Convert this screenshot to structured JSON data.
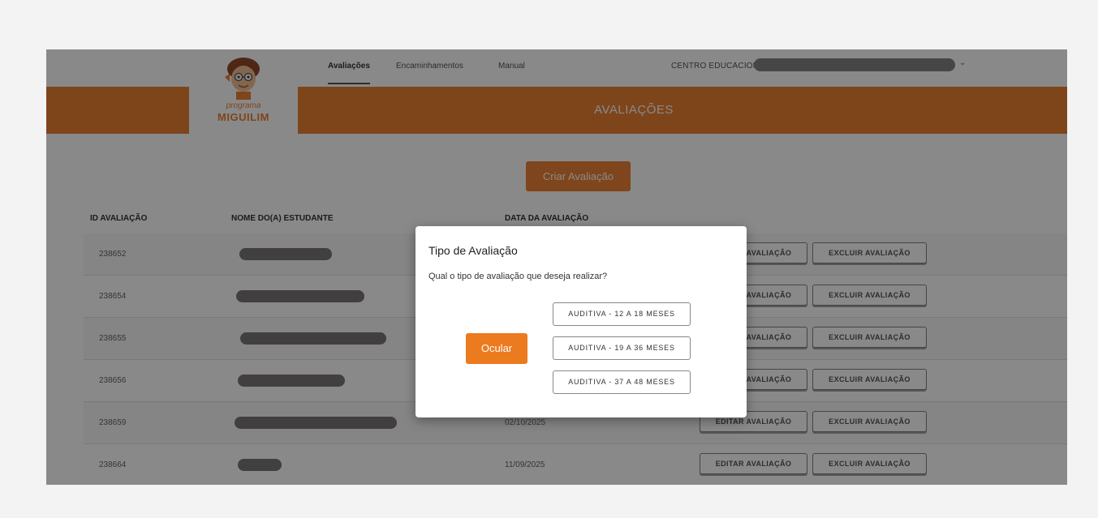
{
  "nav": {
    "links": [
      "Avaliações",
      "Encaminhamentos",
      "Manual"
    ],
    "center_label": "CENTRO EDUCACIONAL",
    "chevron": "⌄"
  },
  "logo": {
    "small": "programa",
    "big": "MIGUILIM"
  },
  "page_title": "AVALIAÇÕES",
  "create_button": "Criar Avaliação",
  "table": {
    "headers": [
      "ID AVALIAÇÃO",
      "NOME DO(A) ESTUDANTE",
      "DATA DA AVALIAÇÃO"
    ],
    "edit_label": "EDITAR AVALIAÇÃO",
    "delete_label": "EXCLUIR AVALIAÇÃO",
    "rows": [
      {
        "id": "238652",
        "date": ""
      },
      {
        "id": "238654",
        "date": ""
      },
      {
        "id": "238655",
        "date": ""
      },
      {
        "id": "238656",
        "date": ""
      },
      {
        "id": "238659",
        "date": "02/10/2025"
      },
      {
        "id": "238664",
        "date": "11/09/2025"
      }
    ]
  },
  "modal": {
    "title": "Tipo de Avaliação",
    "question": "Qual o tipo de avaliação que deseja realizar?",
    "ocular_label": "Ocular",
    "options": [
      "AUDITIVA - 12 A 18 MESES",
      "AUDITIVA - 19 A 36 MESES",
      "AUDITIVA - 37 A 48 MESES"
    ]
  },
  "colors": {
    "brand_orange": "#e87722",
    "redaction": "#6e6a6c"
  },
  "icons": {
    "logo": "miguilim-boy-face-icon",
    "dropdown": "chevron-down-icon"
  }
}
